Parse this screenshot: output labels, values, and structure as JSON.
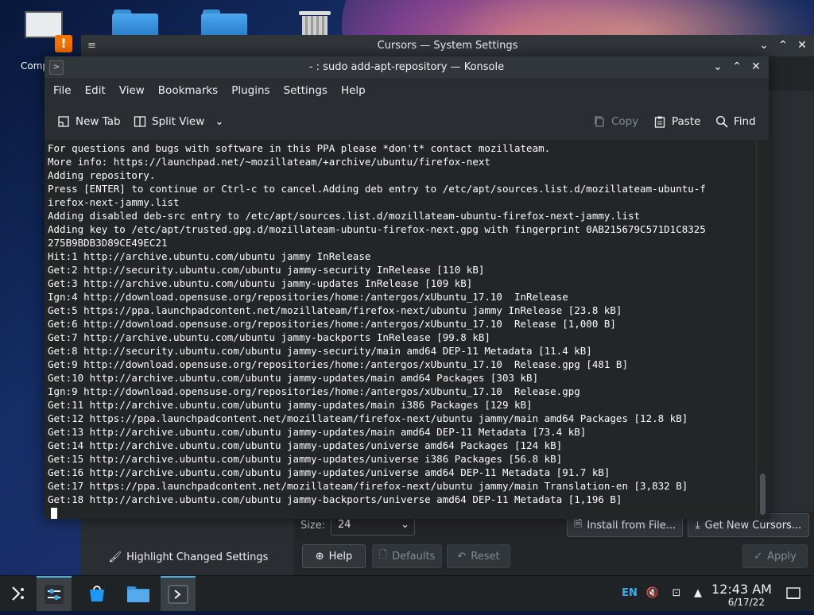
{
  "desktop": {
    "icons": [
      {
        "label": "Comp"
      },
      {
        "label": ""
      },
      {
        "label": ""
      },
      {
        "label": ""
      }
    ]
  },
  "system_settings": {
    "title": "Cursors — System Settings",
    "size_label": "Size:",
    "size_value": "24",
    "install_button": "Install from File...",
    "get_new_button": "Get New Cursors...",
    "highlight_button": "Highlight Changed Settings",
    "help_button": "Help",
    "defaults_button": "Defaults",
    "reset_button": "Reset",
    "apply_button": "Apply"
  },
  "konsole": {
    "title": "- : sudo add-apt-repository — Konsole",
    "menu": [
      "File",
      "Edit",
      "View",
      "Bookmarks",
      "Plugins",
      "Settings",
      "Help"
    ],
    "toolbar": {
      "new_tab": "New Tab",
      "split_view": "Split View",
      "copy": "Copy",
      "paste": "Paste",
      "find": "Find"
    },
    "lines": [
      "For questions and bugs with software in this PPA please *don't* contact mozillateam.",
      "More info: https://launchpad.net/~mozillateam/+archive/ubuntu/firefox-next",
      "Adding repository.",
      "Press [ENTER] to continue or Ctrl-c to cancel.Adding deb entry to /etc/apt/sources.list.d/mozillateam-ubuntu-f",
      "irefox-next-jammy.list",
      "Adding disabled deb-src entry to /etc/apt/sources.list.d/mozillateam-ubuntu-firefox-next-jammy.list",
      "Adding key to /etc/apt/trusted.gpg.d/mozillateam-ubuntu-firefox-next.gpg with fingerprint 0AB215679C571D1C8325",
      "275B9BDB3D89CE49EC21",
      "Hit:1 http://archive.ubuntu.com/ubuntu jammy InRelease",
      "Get:2 http://security.ubuntu.com/ubuntu jammy-security InRelease [110 kB]",
      "Get:3 http://archive.ubuntu.com/ubuntu jammy-updates InRelease [109 kB]",
      "Ign:4 http://download.opensuse.org/repositories/home:/antergos/xUbuntu_17.10  InRelease",
      "Get:5 https://ppa.launchpadcontent.net/mozillateam/firefox-next/ubuntu jammy InRelease [23.8 kB]",
      "Get:6 http://download.opensuse.org/repositories/home:/antergos/xUbuntu_17.10  Release [1,000 B]",
      "Get:7 http://archive.ubuntu.com/ubuntu jammy-backports InRelease [99.8 kB]",
      "Get:8 http://security.ubuntu.com/ubuntu jammy-security/main amd64 DEP-11 Metadata [11.4 kB]",
      "Get:9 http://download.opensuse.org/repositories/home:/antergos/xUbuntu_17.10  Release.gpg [481 B]",
      "Get:10 http://archive.ubuntu.com/ubuntu jammy-updates/main amd64 Packages [303 kB]",
      "Ign:9 http://download.opensuse.org/repositories/home:/antergos/xUbuntu_17.10  Release.gpg",
      "Get:11 http://archive.ubuntu.com/ubuntu jammy-updates/main i386 Packages [129 kB]",
      "Get:12 https://ppa.launchpadcontent.net/mozillateam/firefox-next/ubuntu jammy/main amd64 Packages [12.8 kB]",
      "Get:13 http://archive.ubuntu.com/ubuntu jammy-updates/main amd64 DEP-11 Metadata [73.4 kB]",
      "Get:14 http://archive.ubuntu.com/ubuntu jammy-updates/universe amd64 Packages [124 kB]",
      "Get:15 http://archive.ubuntu.com/ubuntu jammy-updates/universe i386 Packages [56.8 kB]",
      "Get:16 http://archive.ubuntu.com/ubuntu jammy-updates/universe amd64 DEP-11 Metadata [91.7 kB]",
      "Get:17 https://ppa.launchpadcontent.net/mozillateam/firefox-next/ubuntu jammy/main Translation-en [3,832 B]",
      "Get:18 http://archive.ubuntu.com/ubuntu jammy-backports/universe amd64 DEP-11 Metadata [1,196 B]",
      ""
    ]
  },
  "taskbar": {
    "tasks": [
      {
        "icon": "app-launcher-icon"
      },
      {
        "icon": "system-settings-icon"
      },
      {
        "icon": "discover-store-icon"
      },
      {
        "icon": "file-manager-icon"
      },
      {
        "icon": "konsole-icon"
      }
    ],
    "keyboard_layout": "EN",
    "time": "12:43 AM",
    "date": "6/17/22"
  },
  "colors": {
    "accent": "#3daee9",
    "terminal_bg": "#232627",
    "warning": "#f67400"
  }
}
